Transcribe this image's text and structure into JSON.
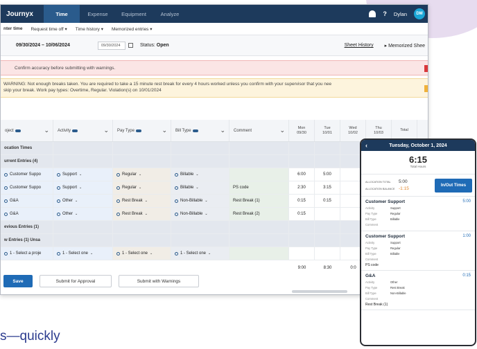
{
  "app": {
    "brand": "Journyx",
    "tabs": [
      "Time",
      "Expense",
      "Equipment",
      "Analyze"
    ],
    "active_tab": "Time",
    "user": "Dylan",
    "avatar_initials": "DM"
  },
  "subnav": [
    "nter time",
    "Request time off ▾",
    "Time history ▾",
    "Memorized entries ▾"
  ],
  "period": {
    "range": "09/30/2024 – 10/06/2024",
    "date_select": "09/30/2024",
    "status_label": "Status:",
    "status": "Open",
    "sheet_history": "Sheet History",
    "memorized_sheets": "▸ Memorized Shee"
  },
  "banners": {
    "confirm": "Confirm accuracy before submitting with warnings.",
    "warning_line1": "WARNING: Not enough breaks taken. You are required to take a 15 minute rest break for every 4 hours worked unless you confirm with your supervisor that you nee",
    "warning_line2": "skip your break. Work pay types: Overtime, Regular. Violation(s) on 10/01/2024"
  },
  "table": {
    "headers": [
      "oject",
      "Activity",
      "Pay Type",
      "Bill Type",
      "Comment"
    ],
    "day_headers": [
      [
        "Mon",
        "09/30"
      ],
      [
        "Tue",
        "10/01"
      ],
      [
        "Wed",
        "10/02"
      ],
      [
        "Thu",
        "10/03"
      ]
    ],
    "total_header": "Total",
    "rows": [
      {
        "type": "section",
        "label": "ocation Times"
      },
      {
        "type": "section",
        "label": "urrent Entries (4)"
      },
      {
        "project": "Customer Suppo",
        "activity": "Support",
        "pay": "Regular",
        "bill": "Billable",
        "comment": "",
        "mon": "6:00",
        "tue": "5:00",
        "wed": "",
        "thu": ""
      },
      {
        "project": "Customer Suppo",
        "activity": "Support",
        "pay": "Regular",
        "bill": "Billable",
        "comment": "PS code",
        "mon": "2:30",
        "tue": "3:15",
        "wed": "",
        "thu": ""
      },
      {
        "project": "G&A",
        "activity": "Other",
        "pay": "Rest Break",
        "bill": "Non-Billable",
        "comment": "Rest Break (1)",
        "mon": "0:15",
        "tue": "0:15",
        "wed": "",
        "thu": ""
      },
      {
        "project": "G&A",
        "activity": "Other",
        "pay": "Rest Break",
        "bill": "Non-Billable",
        "comment": "Rest Break (2)",
        "mon": "0:15",
        "tue": "",
        "wed": "",
        "thu": ""
      },
      {
        "type": "section",
        "label": "evious Entries (1)"
      },
      {
        "type": "section",
        "label": "w Entries (1) Unsa"
      },
      {
        "project": "1 - Select a proje",
        "activity": "1 - Select one",
        "pay": "1 - Select one",
        "bill": "1 - Select one",
        "comment": "",
        "mon": "",
        "tue": "",
        "wed": "",
        "thu": ""
      }
    ],
    "totals": {
      "mon": "9:00",
      "tue": "8:30",
      "wed": "0:0"
    }
  },
  "footer": {
    "save": "Save",
    "submit_approval": "Submit for Approval",
    "submit_warnings": "Submit with Warnings"
  },
  "tagline": "s—quickly",
  "mobile": {
    "date": "Tuesday, October 1, 2024",
    "total_hours": "6:15",
    "total_label": "Total Hours",
    "alloc_total_label": "ALLOCATION TOTAL",
    "alloc_total": "5:00",
    "alloc_balance_label": "ALLOCATION BALANCE",
    "alloc_balance": "-1:15",
    "inout_button": "In/Out Times",
    "entries": [
      {
        "title": "Customer Support",
        "hours": "5:00",
        "activity": "Support",
        "pay": "Regular",
        "bill": "Billable",
        "comment": ""
      },
      {
        "title": "Customer Support",
        "hours": "1:00",
        "activity": "Support",
        "pay": "Regular",
        "bill": "Billable",
        "comment": "PS code"
      },
      {
        "title": "G&A",
        "hours": "0:15",
        "activity": "Other",
        "pay": "Rest Break",
        "bill": "Non-Billable",
        "comment": "Rest Break (1)"
      }
    ],
    "labels": {
      "activity": "Activity",
      "pay": "Pay Type",
      "bill": "Bill Type",
      "comment": "Comment"
    }
  }
}
